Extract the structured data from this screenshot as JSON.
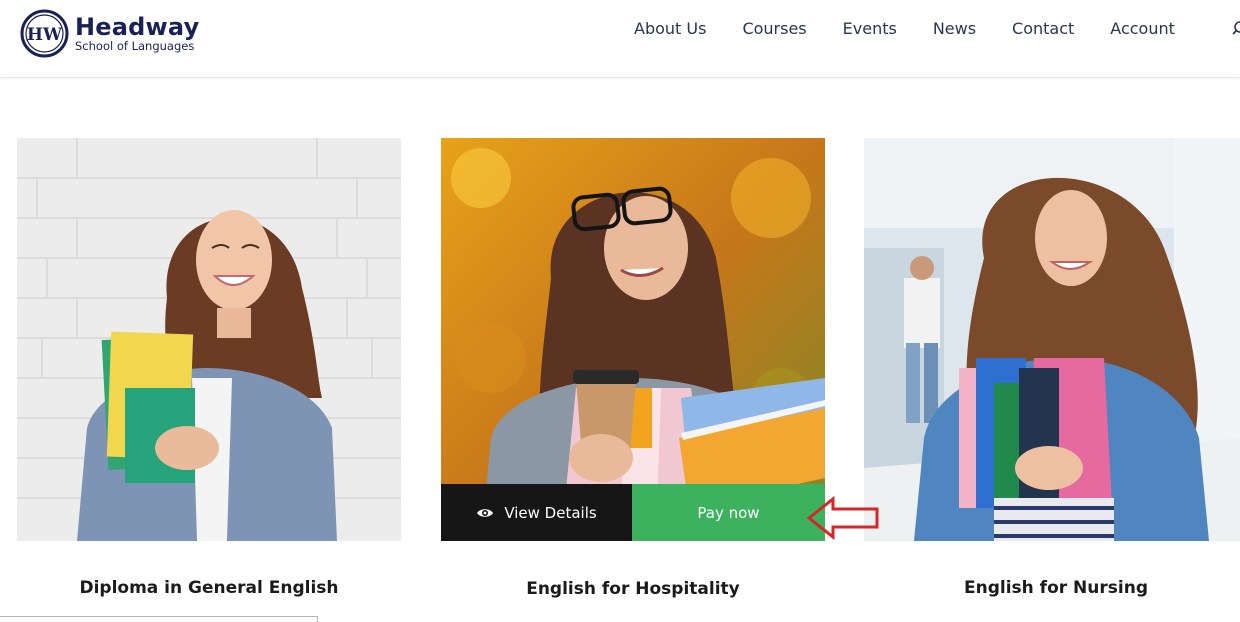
{
  "brand": {
    "monogram": "HW",
    "name": "Headway",
    "subtitle": "School of Languages",
    "color": "#1a2156"
  },
  "nav": {
    "items": [
      {
        "label": "About Us"
      },
      {
        "label": "Courses"
      },
      {
        "label": "Events"
      },
      {
        "label": "News"
      },
      {
        "label": "Contact"
      },
      {
        "label": "Account"
      }
    ],
    "search_icon": "search-icon"
  },
  "courses": [
    {
      "title": "Diploma in General English",
      "image": "student-with-yellow-folders-photo"
    },
    {
      "title": "English for Hospitality",
      "image": "student-with-coffee-and-books-photo",
      "actions": {
        "view_label": "View Details",
        "pay_label": "Pay now"
      }
    },
    {
      "title": "English for Nursing",
      "image": "student-with-pink-scarf-photo"
    }
  ],
  "colors": {
    "pay_button": "#3cb25f",
    "view_button": "#161616",
    "annotation_arrow": "#d6262b"
  }
}
